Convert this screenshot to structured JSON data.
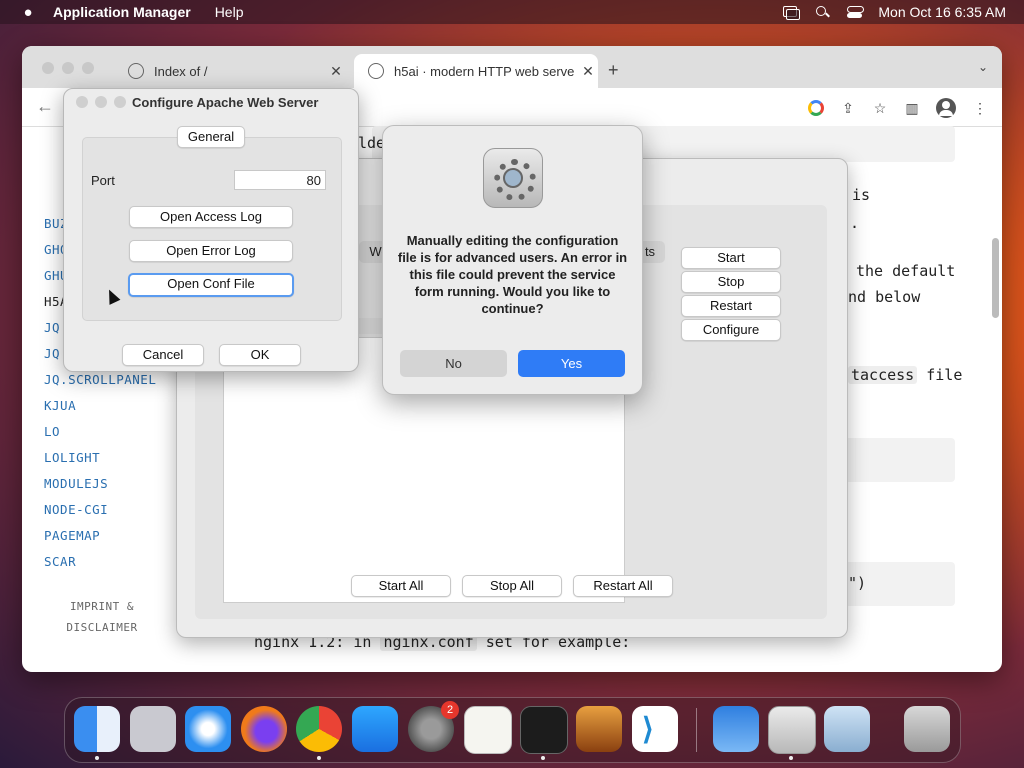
{
  "menubar": {
    "app_name": "Application Manager",
    "menus": [
      "Help"
    ],
    "datetime": "Mon Oct 16  6:35 AM"
  },
  "browser": {
    "tabs": [
      {
        "title": "Index of /"
      },
      {
        "title": "h5ai · modern HTTP web serve"
      }
    ],
    "new_tab": "+",
    "tab_menu": "⌄"
  },
  "page": {
    "nav": [
      "BUZ",
      "GHO",
      "GHU",
      "H5A",
      "JQ.",
      "JQ.",
      "JQ.SCROLLPANEL",
      "KJUA",
      "LO",
      "LOLIGHT",
      "MODULEJS",
      "NODE-CGI",
      "PAGEMAP",
      "SCAR"
    ],
    "imprint": [
      "IMPRINT &",
      "DISCLAIMER"
    ],
    "frag1": "lder",
    "frag2": "is",
    "frag3": ".",
    "frag4": "the default",
    "frag5": "nd below",
    "frag6": "taccess",
    "frag6b": "file",
    "frag7": "\")",
    "nginx_pre": "nginx 1.2: in",
    "nginx_code": "nginx.conf",
    "nginx_post": "set for example:"
  },
  "appmgr": {
    "tab_partial_left": "We",
    "tab_partial_right": "ts",
    "list_fragment": "r",
    "side_buttons": [
      "Start",
      "Stop",
      "Restart",
      "Configure"
    ],
    "bottom_buttons": [
      "Start All",
      "Stop All",
      "Restart All"
    ]
  },
  "configure": {
    "title": "Configure Apache Web Server",
    "tab": "General",
    "port_label": "Port",
    "port_value": "80",
    "buttons": [
      "Open Access Log",
      "Open Error Log",
      "Open Conf File"
    ],
    "cancel": "Cancel",
    "ok": "OK"
  },
  "alert": {
    "message": "Manually editing the configuration file is for advanced users. An error in this file could prevent the service form running. Would you like to continue?",
    "no": "No",
    "yes": "Yes"
  },
  "dock": {
    "settings_badge": "2"
  }
}
